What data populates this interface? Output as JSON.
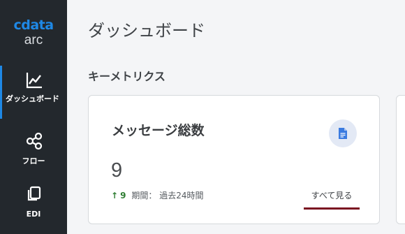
{
  "sidebar": {
    "logo_mark": "cdata",
    "logo_sub": "arc",
    "items": [
      {
        "label": "ダッシュボード",
        "icon": "line-chart-icon",
        "active": true
      },
      {
        "label": "フロー",
        "icon": "share-nodes-icon",
        "active": false
      },
      {
        "label": "EDI",
        "icon": "copy-documents-icon",
        "active": false
      }
    ],
    "accent": "#1e88e5"
  },
  "main": {
    "page_title": "ダッシュボード",
    "section_title": "キーメトリクス",
    "card": {
      "title": "メッセージ総数",
      "icon": "document-icon",
      "value": "9",
      "trend_arrow": "↑",
      "trend_count": "9",
      "period_label": "期間： 過去24時間",
      "see_all": "すべて見る",
      "trend_color": "#2e7d32",
      "link_underline_color": "#7a1020"
    }
  }
}
